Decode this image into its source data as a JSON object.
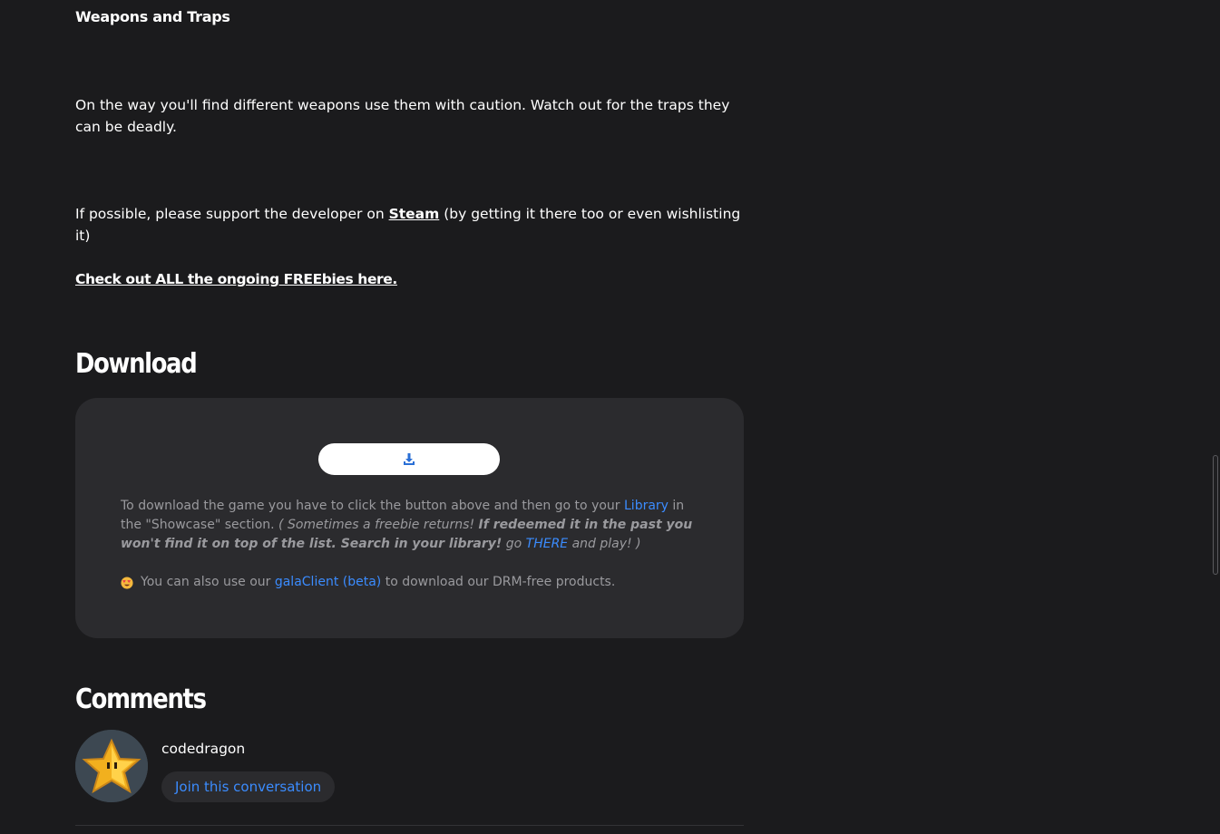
{
  "article": {
    "weapons_heading": "Weapons and Traps",
    "weapons_text": "On the way you'll find different weapons use them with caution. Watch out for the traps they can be deadly.",
    "support_prefix": "If possible, please support the developer on ",
    "support_link": "Steam",
    "support_suffix": " (by getting it there too or even wishlisting it)",
    "freebies_link": "Check out ALL the ongoing FREEbies here."
  },
  "download": {
    "heading": "Download",
    "button_icon": "download-icon",
    "info_1": "To download the game you have to click the button above and then go to your ",
    "info_library_link": "Library",
    "info_2": " in the \"Showcase\" section. ",
    "info_italic_1": "( Sometimes a freebie returns! ",
    "info_bold_italic": "If redeemed it in the past you won't find it on top of the list. Search in your library!",
    "info_italic_2": " go ",
    "info_there_link": "THERE",
    "info_italic_3": " and play! )",
    "client_prefix": "You can also use our ",
    "client_link": "galaClient (beta)",
    "client_suffix": " to download our DRM-free products.",
    "emoji_icon": "heart-eyes-emoji-icon"
  },
  "comments": {
    "heading": "Comments",
    "username": "codedragon",
    "join_label": "Join this conversation",
    "avatar_icon": "star-avatar-icon"
  },
  "colors": {
    "background": "#1b1b1d",
    "card": "#2b2b2e",
    "link_blue": "#3b8cff",
    "muted_text": "#9a9a9e"
  }
}
